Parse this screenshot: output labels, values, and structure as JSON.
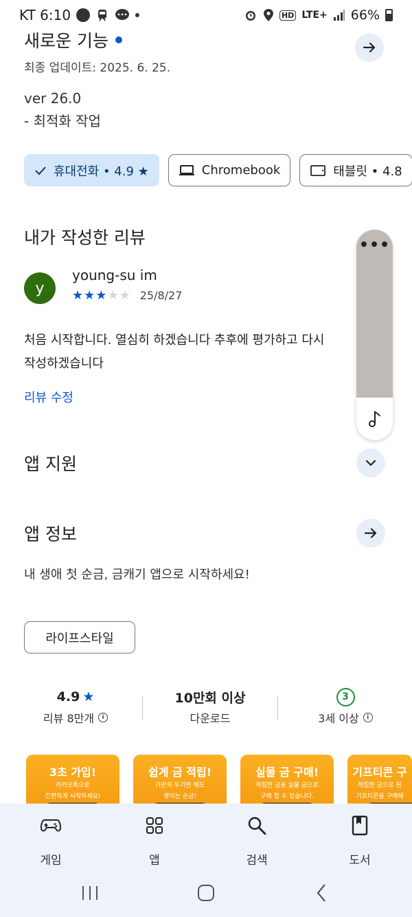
{
  "status_bar": {
    "carrier_time": "KT 6:10",
    "hd": "HD",
    "network": "LTE+",
    "battery": "66%"
  },
  "whats_new": {
    "title": "새로운 기능",
    "updated": "최종 업데이트: 2025. 6. 25.",
    "version": "ver 26.0",
    "notes": "- 최적화 작업"
  },
  "device_chips": [
    {
      "label": "휴대전화 • 4.9 ★",
      "icon": "check-icon",
      "selected": true
    },
    {
      "label": "Chromebook",
      "icon": "laptop-icon",
      "selected": false
    },
    {
      "label": "태블릿 • 4.8",
      "icon": "tablet-icon",
      "selected": false
    }
  ],
  "my_review": {
    "heading": "내가 작성한 리뷰",
    "avatar_letter": "y",
    "avatar_color": "#2f6e0e",
    "reviewer": "young-su im",
    "rating": 3,
    "max_rating": 5,
    "date": "25/8/27",
    "text_line1": "처음 시작합니다. 열심히 하겠습니다 추후에 평가하고 다시",
    "text_line2": "작성하겠습니다",
    "edit_label": "리뷰 수정"
  },
  "floating_panel": {
    "menu_icon": "more-icon",
    "bottom_icon": "music-note-icon"
  },
  "app_support": {
    "title": "앱 지원"
  },
  "app_info": {
    "title": "앱 정보",
    "description": "내 생애 첫 순금, 금캐기 앱으로 시작하세요!",
    "category": "라이프스타일"
  },
  "stats": {
    "rating_value": "4.9",
    "rating_label": "리뷰 8만개",
    "downloads_value": "10만회 이상",
    "downloads_label": "다운로드",
    "age_value": "3",
    "age_label": "3세 이상"
  },
  "screenshots": [
    {
      "title": "3초 가입!",
      "sub1": "카카오톡으로",
      "sub2": "간편하게 시작하세요!"
    },
    {
      "title": "쉽게 금 적립!",
      "sub1": "가만히 두기만 해도",
      "sub2": "쌓이는 순금!"
    },
    {
      "title": "실물 금 구매!",
      "sub1": "적립한 금을 실물 금으로",
      "sub2": "구매 할 수 있습니다."
    },
    {
      "title": "기프티콘 구",
      "sub1": "적립한 금으로 원",
      "sub2": "기프티콘을 구매해"
    }
  ],
  "bottom_nav": [
    {
      "label": "게임",
      "icon": "gamepad-icon"
    },
    {
      "label": "앱",
      "icon": "apps-grid-icon"
    },
    {
      "label": "검색",
      "icon": "search-icon"
    },
    {
      "label": "도서",
      "icon": "book-icon"
    }
  ],
  "colors": {
    "accent": "#0b57d0",
    "chip_selected_bg": "#d3e7f8",
    "nav_bg": "#edf2fb",
    "age_badge": "#1e8e3e",
    "screenshot_bg": "#f9a61a"
  }
}
